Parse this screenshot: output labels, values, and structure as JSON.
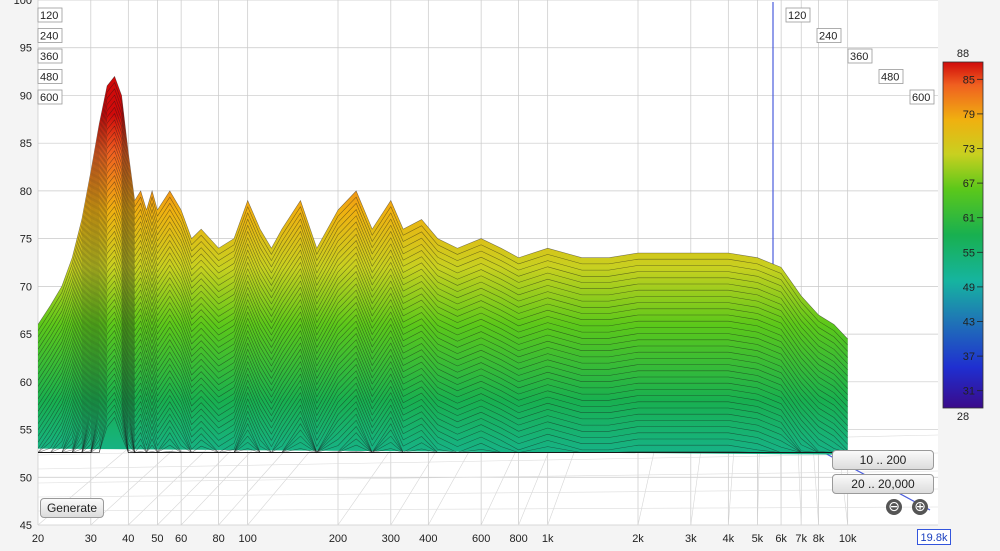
{
  "chart_data": {
    "type": "area",
    "description_free": true,
    "x_scale": "log",
    "x_range": [
      20,
      20000
    ],
    "y_range": [
      45,
      100
    ],
    "x_ticks": [
      {
        "v": 20,
        "label": "20"
      },
      {
        "v": 30,
        "label": "30"
      },
      {
        "v": 40,
        "label": "40"
      },
      {
        "v": 50,
        "label": "50"
      },
      {
        "v": 60,
        "label": "60"
      },
      {
        "v": 80,
        "label": "80"
      },
      {
        "v": 100,
        "label": "100"
      },
      {
        "v": 200,
        "label": "200"
      },
      {
        "v": 300,
        "label": "300"
      },
      {
        "v": 400,
        "label": "400"
      },
      {
        "v": 600,
        "label": "600"
      },
      {
        "v": 800,
        "label": "800"
      },
      {
        "v": 1000,
        "label": "1k"
      },
      {
        "v": 2000,
        "label": "2k"
      },
      {
        "v": 3000,
        "label": "3k"
      },
      {
        "v": 4000,
        "label": "4k"
      },
      {
        "v": 5000,
        "label": "5k"
      },
      {
        "v": 6000,
        "label": "6k"
      },
      {
        "v": 7000,
        "label": "7k"
      },
      {
        "v": 8000,
        "label": "8k"
      },
      {
        "v": 10000,
        "label": "10k"
      }
    ],
    "y_ticks": [
      {
        "v": 45,
        "label": "45"
      },
      {
        "v": 50,
        "label": "50"
      },
      {
        "v": 55,
        "label": "55"
      },
      {
        "v": 60,
        "label": "60"
      },
      {
        "v": 65,
        "label": "65"
      },
      {
        "v": 70,
        "label": "70"
      },
      {
        "v": 75,
        "label": "75"
      },
      {
        "v": 80,
        "label": "80"
      },
      {
        "v": 85,
        "label": "85"
      },
      {
        "v": 90,
        "label": "90"
      },
      {
        "v": 95,
        "label": "95"
      },
      {
        "v": 100,
        "label": "100"
      }
    ],
    "z_ticks": [
      "120",
      "240",
      "360",
      "480",
      "600"
    ],
    "surface_front": [
      [
        20,
        66
      ],
      [
        22,
        68
      ],
      [
        24,
        70
      ],
      [
        26,
        73
      ],
      [
        28,
        77
      ],
      [
        30,
        82
      ],
      [
        32,
        87
      ],
      [
        34,
        91
      ],
      [
        36,
        92
      ],
      [
        38,
        90
      ],
      [
        40,
        84
      ],
      [
        42,
        79
      ],
      [
        44,
        80
      ],
      [
        46,
        78
      ],
      [
        48,
        80
      ],
      [
        50,
        78
      ],
      [
        55,
        80
      ],
      [
        60,
        78
      ],
      [
        65,
        75
      ],
      [
        70,
        76
      ],
      [
        80,
        74
      ],
      [
        90,
        75
      ],
      [
        100,
        79
      ],
      [
        110,
        76
      ],
      [
        120,
        74
      ],
      [
        130,
        76
      ],
      [
        150,
        79
      ],
      [
        170,
        74
      ],
      [
        200,
        78
      ],
      [
        230,
        80
      ],
      [
        260,
        76
      ],
      [
        300,
        79
      ],
      [
        330,
        76
      ],
      [
        380,
        77
      ],
      [
        430,
        75
      ],
      [
        500,
        74
      ],
      [
        600,
        75
      ],
      [
        700,
        74
      ],
      [
        800,
        73
      ],
      [
        1000,
        74
      ],
      [
        1300,
        73
      ],
      [
        1600,
        73
      ],
      [
        2000,
        73.5
      ],
      [
        3000,
        73.5
      ],
      [
        4000,
        73.5
      ],
      [
        5000,
        73
      ],
      [
        6000,
        72
      ],
      [
        7000,
        69
      ],
      [
        8000,
        67
      ],
      [
        9000,
        66
      ],
      [
        10000,
        64.5
      ]
    ],
    "surface_base": 53,
    "colorbar": {
      "max": "88",
      "min": "28",
      "ticks": [
        {
          "v": 85,
          "label": "85"
        },
        {
          "v": 79,
          "label": "79"
        },
        {
          "v": 73,
          "label": "73"
        },
        {
          "v": 67,
          "label": "67"
        },
        {
          "v": 61,
          "label": "61"
        },
        {
          "v": 55,
          "label": "55"
        },
        {
          "v": 49,
          "label": "49"
        },
        {
          "v": 43,
          "label": "43"
        },
        {
          "v": 37,
          "label": "37"
        },
        {
          "v": 31,
          "label": "31"
        }
      ],
      "stops": [
        {
          "v": 28,
          "color": "#3a0a8a"
        },
        {
          "v": 35,
          "color": "#1f2fd0"
        },
        {
          "v": 43,
          "color": "#1f74b6"
        },
        {
          "v": 50,
          "color": "#16b4a0"
        },
        {
          "v": 58,
          "color": "#18b050"
        },
        {
          "v": 66,
          "color": "#5cc81a"
        },
        {
          "v": 72,
          "color": "#c8d020"
        },
        {
          "v": 78,
          "color": "#f0b010"
        },
        {
          "v": 84,
          "color": "#f06020"
        },
        {
          "v": 88,
          "color": "#d00a0a"
        }
      ]
    }
  },
  "controls": {
    "generate_label": "Generate",
    "range1_label": "10 .. 200",
    "range2_label": "20 .. 20,000",
    "zoom_out_symbol": "⊖",
    "zoom_in_symbol": "⊕",
    "freq_readout": "19.8k"
  },
  "colors": {
    "grid": "#c8c8c8",
    "depth_axis": "#4a5cdc",
    "contour": "#1a1a1a"
  }
}
